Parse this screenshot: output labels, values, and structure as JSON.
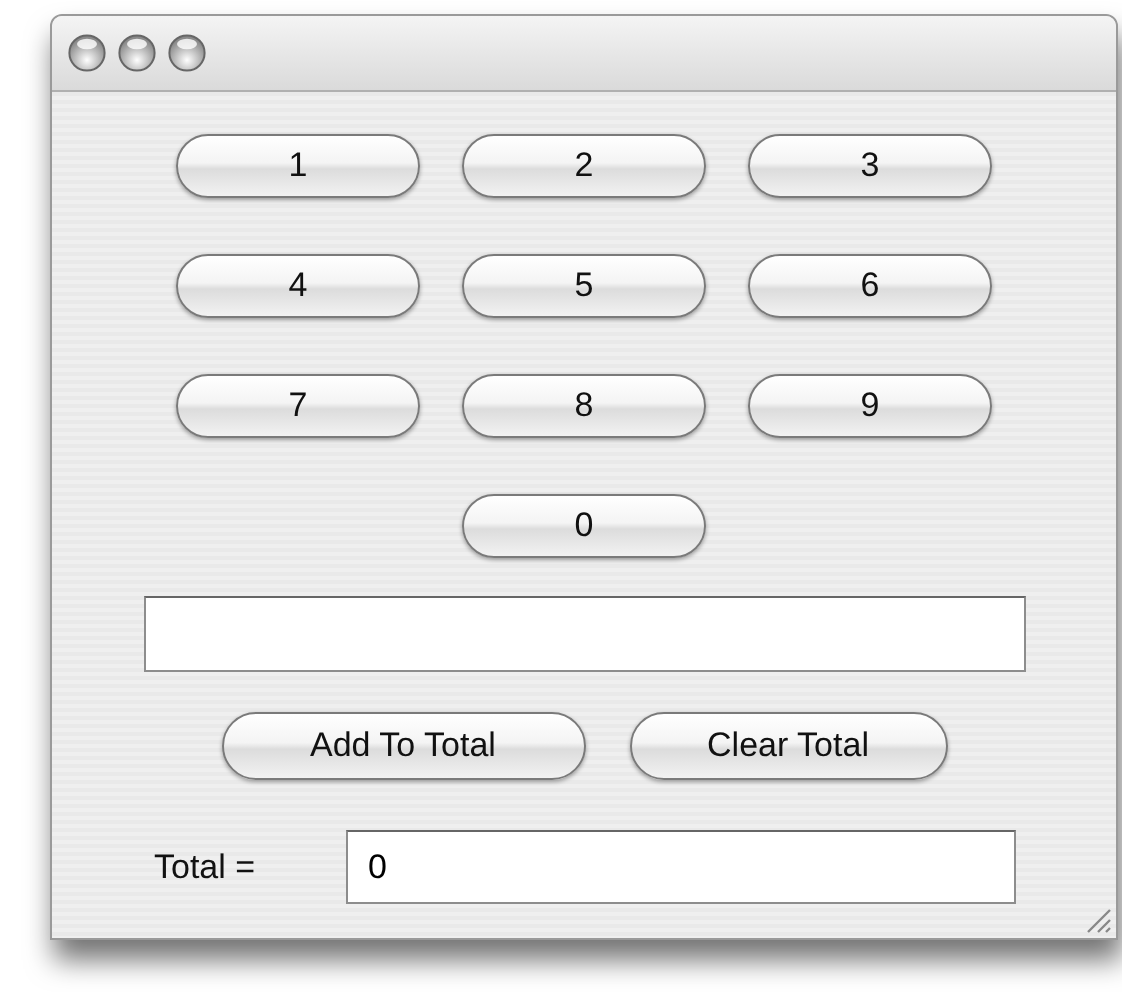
{
  "keypad": [
    "1",
    "2",
    "3",
    "4",
    "5",
    "6",
    "7",
    "8",
    "9",
    "0"
  ],
  "actions": [
    "Add To Total",
    "Clear Total"
  ],
  "total": {
    "label": "Total =",
    "value": "0"
  }
}
